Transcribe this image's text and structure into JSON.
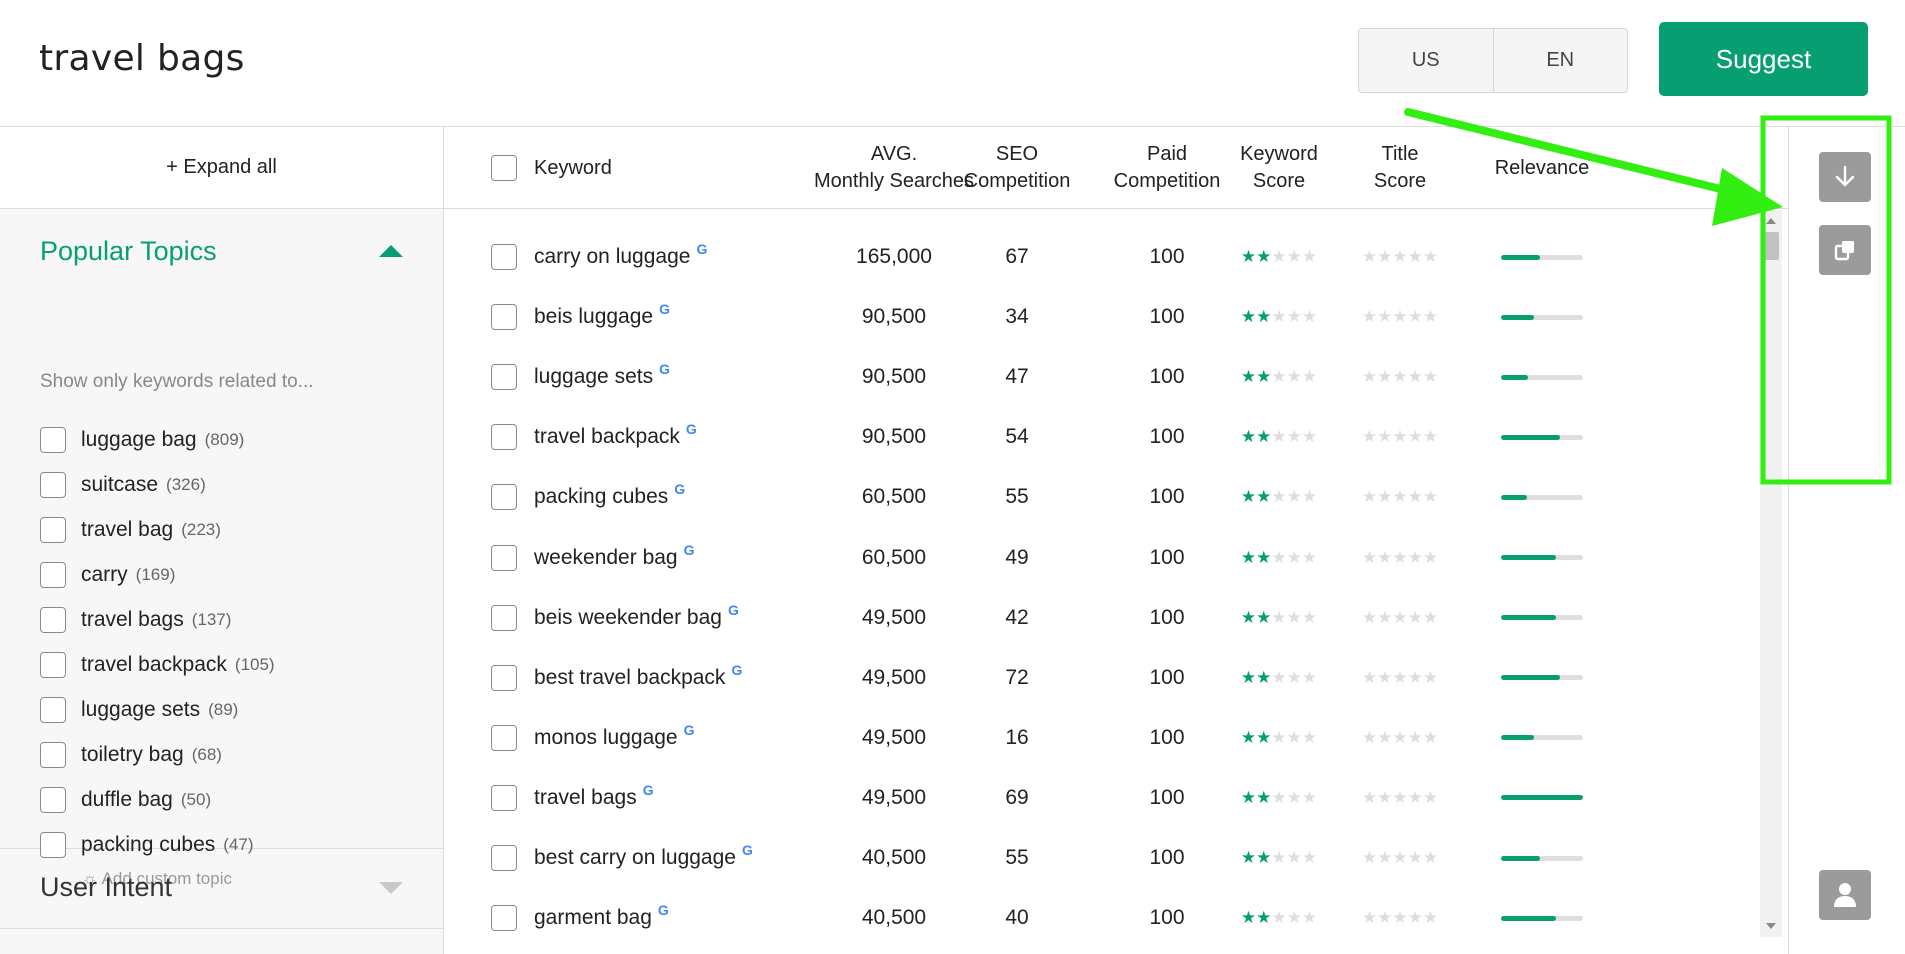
{
  "search": {
    "query": "travel bags"
  },
  "locale": {
    "country": "US",
    "language": "EN"
  },
  "actions": {
    "suggest_label": "Suggest"
  },
  "sidebar": {
    "expand_all_label": "+ Expand all",
    "popular_topics": {
      "title": "Popular Topics",
      "hint": "Show only keywords related to...",
      "items": [
        {
          "name": "luggage bag",
          "count": "(809)"
        },
        {
          "name": "suitcase",
          "count": "(326)"
        },
        {
          "name": "travel bag",
          "count": "(223)"
        },
        {
          "name": "carry",
          "count": "(169)"
        },
        {
          "name": "travel bags",
          "count": "(137)"
        },
        {
          "name": "travel backpack",
          "count": "(105)"
        },
        {
          "name": "luggage sets",
          "count": "(89)"
        },
        {
          "name": "toiletry bag",
          "count": "(68)"
        },
        {
          "name": "duffle bag",
          "count": "(50)"
        },
        {
          "name": "packing cubes",
          "count": "(47)"
        }
      ],
      "add_custom_label": "Add custom topic"
    },
    "user_intent": {
      "title": "User Intent"
    }
  },
  "table": {
    "headers": {
      "keyword": "Keyword",
      "avg_line1": "AVG.",
      "avg_line2": "Monthly Searches",
      "seo_line1": "SEO",
      "seo_line2": "Competition",
      "paid_line1": "Paid",
      "paid_line2": "Competition",
      "kscore_line1": "Keyword",
      "kscore_line2": "Score",
      "tscore_line1": "Title",
      "tscore_line2": "Score",
      "relevance": "Relevance"
    },
    "google_mark": "G",
    "rows": [
      {
        "keyword": "carry on luggage",
        "searches": "165,000",
        "seo": "67",
        "paid": "100",
        "keyword_stars": 2,
        "title_stars": 0,
        "relevance": 0.48
      },
      {
        "keyword": "beis luggage",
        "searches": "90,500",
        "seo": "34",
        "paid": "100",
        "keyword_stars": 2,
        "title_stars": 0,
        "relevance": 0.4
      },
      {
        "keyword": "luggage sets",
        "searches": "90,500",
        "seo": "47",
        "paid": "100",
        "keyword_stars": 2,
        "title_stars": 0,
        "relevance": 0.33
      },
      {
        "keyword": "travel backpack",
        "searches": "90,500",
        "seo": "54",
        "paid": "100",
        "keyword_stars": 2,
        "title_stars": 0,
        "relevance": 0.72
      },
      {
        "keyword": "packing cubes",
        "searches": "60,500",
        "seo": "55",
        "paid": "100",
        "keyword_stars": 2,
        "title_stars": 0,
        "relevance": 0.32
      },
      {
        "keyword": "weekender bag",
        "searches": "60,500",
        "seo": "49",
        "paid": "100",
        "keyword_stars": 2,
        "title_stars": 0,
        "relevance": 0.67
      },
      {
        "keyword": "beis weekender bag",
        "searches": "49,500",
        "seo": "42",
        "paid": "100",
        "keyword_stars": 2,
        "title_stars": 0,
        "relevance": 0.67
      },
      {
        "keyword": "best travel backpack",
        "searches": "49,500",
        "seo": "72",
        "paid": "100",
        "keyword_stars": 2,
        "title_stars": 0,
        "relevance": 0.72
      },
      {
        "keyword": "monos luggage",
        "searches": "49,500",
        "seo": "16",
        "paid": "100",
        "keyword_stars": 2,
        "title_stars": 0,
        "relevance": 0.4
      },
      {
        "keyword": "travel bags",
        "searches": "49,500",
        "seo": "69",
        "paid": "100",
        "keyword_stars": 2,
        "title_stars": 0,
        "relevance": 1.0
      },
      {
        "keyword": "best carry on luggage",
        "searches": "40,500",
        "seo": "55",
        "paid": "100",
        "keyword_stars": 2,
        "title_stars": 0,
        "relevance": 0.47
      },
      {
        "keyword": "garment bag",
        "searches": "40,500",
        "seo": "40",
        "paid": "100",
        "keyword_stars": 2,
        "title_stars": 0,
        "relevance": 0.67
      }
    ]
  },
  "rail": {
    "icons": [
      "download-icon",
      "copy-icon",
      "user-icon"
    ]
  },
  "colors": {
    "brand": "#079f72",
    "annotation": "#33ee11",
    "rail_button": "#9b9b9b"
  }
}
